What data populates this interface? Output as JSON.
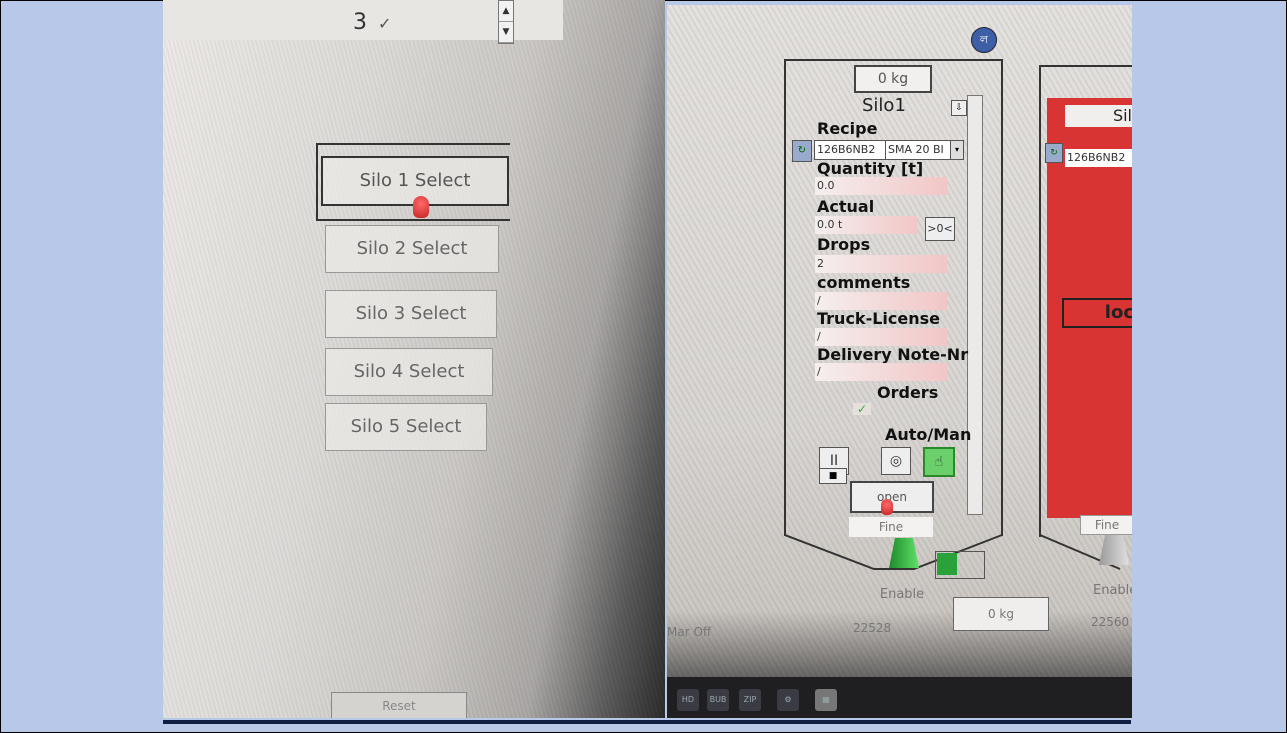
{
  "left_photo": {
    "top_value": "3",
    "top_check": "✓",
    "scroll_up": "▲",
    "scroll_down": "▼",
    "buttons": [
      {
        "label": "Silo 1 Select"
      },
      {
        "label": "Silo 2 Select"
      },
      {
        "label": "Silo 3 Select"
      },
      {
        "label": "Silo 4 Select"
      },
      {
        "label": "Silo 5 Select"
      }
    ],
    "reset_label": "Reset"
  },
  "right_photo": {
    "logo_text": "ল",
    "silo1": {
      "weight_top": "0 kg",
      "title": "Silo1",
      "pin": "⇩",
      "recipe_label": "Recipe",
      "recipe_icon": "↻",
      "recipe_code": "126B6NB2",
      "recipe_name": "SMA 20 BI",
      "recipe_dd": "▾",
      "quantity_label": "Quantity [t]",
      "quantity_value": "0.0",
      "actual_label": "Actual",
      "actual_value": "0.0 t",
      "zero_label": ">0<",
      "drops_label": "Drops",
      "drops_value": "2",
      "comments_label": "comments",
      "comments_value": "/",
      "truck_label": "Truck-License",
      "truck_value": "/",
      "delivery_label": "Delivery Note-Nr",
      "delivery_value": "/",
      "orders_label": "Orders",
      "orders_check": "✓",
      "auto_label": "Auto/Man",
      "pause_label": "II",
      "auto_icon": "◎",
      "manual_icon": "☝",
      "stop_label": "■",
      "open_label": "open",
      "fine_label": "Fine",
      "enable_label": "Enable",
      "counter": "22528"
    },
    "silo2": {
      "title_partial": "Sil",
      "recipe_icon": "↻",
      "recipe_code": "126B6NB2",
      "lock_partial": "loc",
      "fine_label": "Fine",
      "enable_label": "Enable",
      "counter": "22560"
    },
    "weight_bottom": "0 kg",
    "mar_off": "Mar Off",
    "taskbar_items": [
      "HD",
      "BUB",
      "ZIP",
      "⚙",
      "▦"
    ]
  }
}
